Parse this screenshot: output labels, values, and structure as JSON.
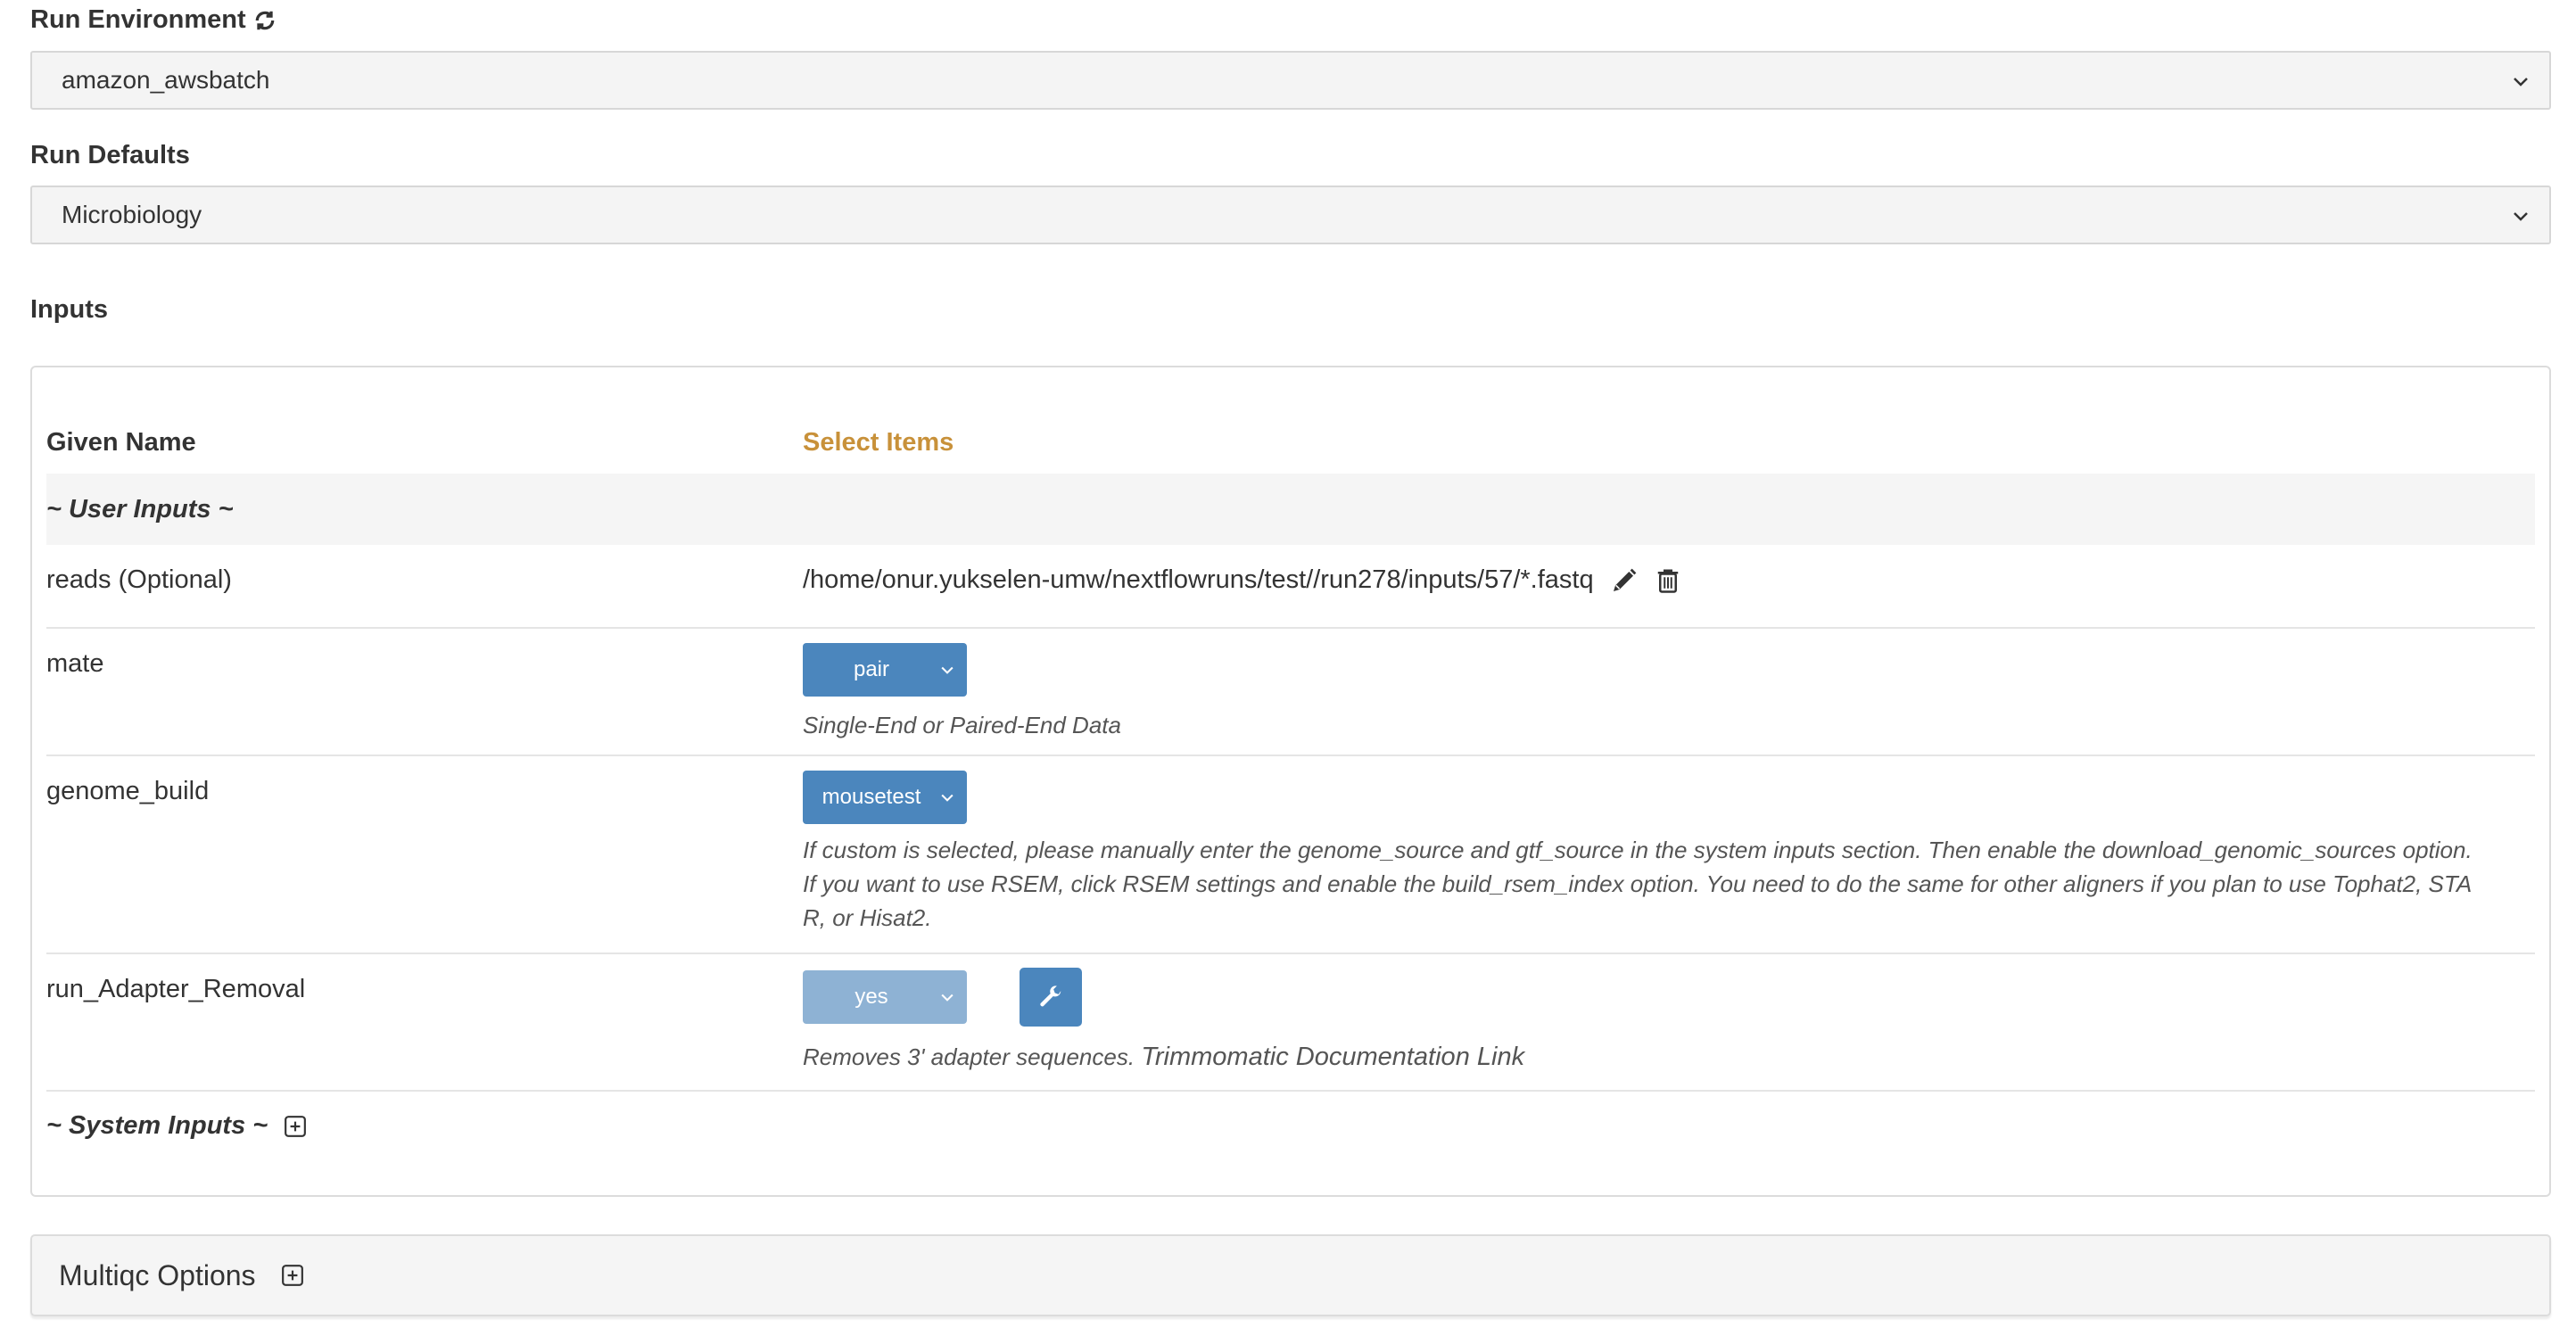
{
  "run_environment": {
    "label": "Run Environment",
    "selected": "amazon_awsbatch",
    "refresh_icon": "refresh-icon"
  },
  "run_defaults": {
    "label": "Run Defaults",
    "selected": "Microbiology"
  },
  "inputs": {
    "label": "Inputs",
    "headers": {
      "name": "Given Name",
      "items": "Select Items"
    },
    "header_accent_color": "#c8913a",
    "user_inputs_label": "~ User Inputs ~",
    "system_inputs_label": "~ System Inputs ~",
    "rows": {
      "reads": {
        "name": "reads (Optional)",
        "value": "/home/onur.yukselen-umw/nextflowruns/test//run278/inputs/57/*.fastq",
        "icons": [
          "pencil-icon",
          "trash-icon"
        ]
      },
      "mate": {
        "name": "mate",
        "selected": "pair",
        "help": "Single-End or Paired-End Data"
      },
      "genome_build": {
        "name": "genome_build",
        "selected": "mousetest",
        "help_line1": "If custom is selected, please manually enter the genome_source and gtf_source in the system inputs section. Then enable the download_genomic_sources option.",
        "help_line2": "If you want to use RSEM, click RSEM settings and enable the build_rsem_index option. You need to do the same for other aligners if you plan to use Tophat2, STA",
        "help_line3": "R, or Hisat2."
      },
      "run_adapter_removal": {
        "name": "run_Adapter_Removal",
        "selected": "yes",
        "help": "Removes 3' adapter sequences.",
        "link": "Trimmomatic Documentation Link",
        "button_icon": "wrench-icon"
      }
    }
  },
  "multiqc": {
    "label": "Multiqc Options",
    "expand_icon": "plus-square-icon"
  },
  "colors": {
    "primary_button": "#4b86bd",
    "disabled_button": "#8eb2d4",
    "panel_border": "#dcdcdc",
    "select_bg": "#f4f4f4"
  }
}
